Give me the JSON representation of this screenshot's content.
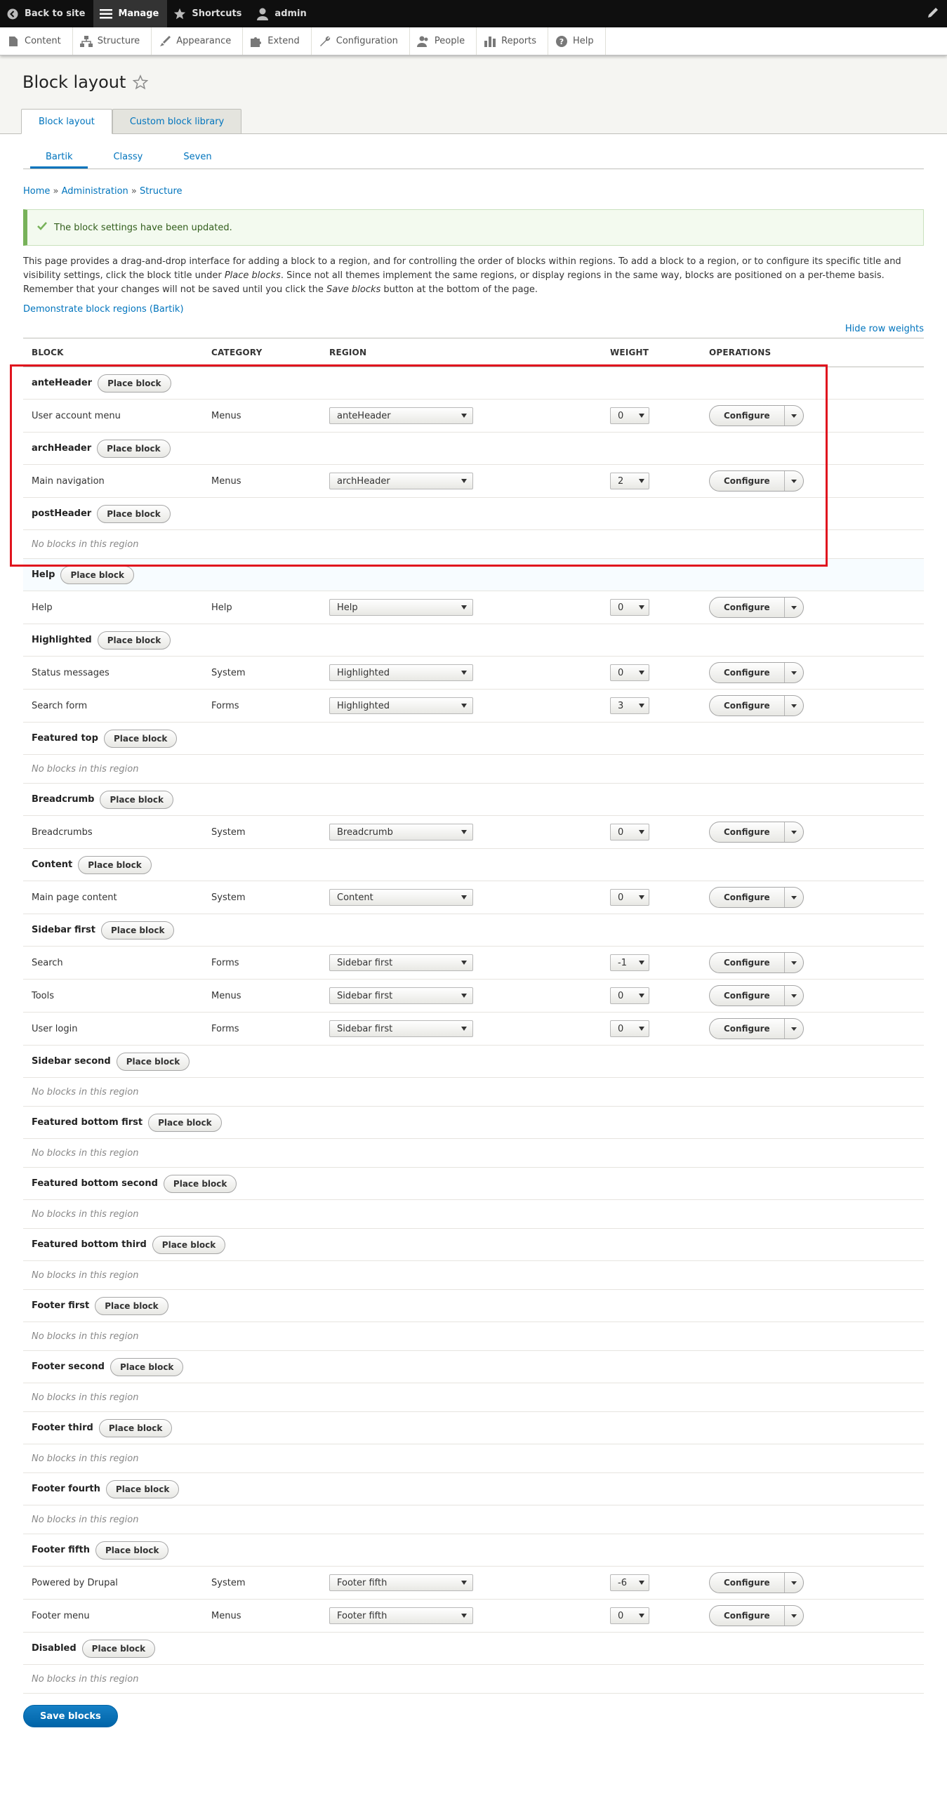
{
  "toolbar": {
    "items": [
      {
        "label": "Back to site",
        "icon": "back-arrow-icon"
      },
      {
        "label": "Manage",
        "icon": "hamburger-icon"
      },
      {
        "label": "Shortcuts",
        "icon": "star-icon"
      },
      {
        "label": "admin",
        "icon": "user-icon"
      }
    ],
    "edit_icon": "pencil-icon"
  },
  "tray": {
    "items": [
      {
        "label": "Content",
        "icon": "document-icon"
      },
      {
        "label": "Structure",
        "icon": "structure-icon"
      },
      {
        "label": "Appearance",
        "icon": "brush-icon"
      },
      {
        "label": "Extend",
        "icon": "puzzle-icon"
      },
      {
        "label": "Configuration",
        "icon": "wrench-icon"
      },
      {
        "label": "People",
        "icon": "people-icon"
      },
      {
        "label": "Reports",
        "icon": "bars-icon"
      },
      {
        "label": "Help",
        "icon": "question-icon"
      }
    ]
  },
  "page": {
    "title": "Block layout",
    "primary_tabs": [
      "Block layout",
      "Custom block library"
    ],
    "secondary_tabs": [
      "Bartik",
      "Classy",
      "Seven"
    ],
    "breadcrumb": [
      "Home",
      "Administration",
      "Structure"
    ],
    "breadcrumb_sep": "»",
    "message": "The block settings have been updated.",
    "help_text_1": "This page provides a drag-and-drop interface for adding a block to a region, and for controlling the order of blocks within regions. To add a block to a region, or to configure its specific title and visibility settings, click the block title under ",
    "help_em_1": "Place blocks",
    "help_text_2": ". Since not all themes implement the same regions, or display regions in the same way, blocks are positioned on a per-theme basis. Remember that your changes will not be saved until you click the ",
    "help_em_2": "Save blocks",
    "help_text_3": " button at the bottom of the page.",
    "demo_link": "Demonstrate block regions (Bartik)",
    "hide_row_weights": "Hide row weights",
    "save_button": "Save blocks"
  },
  "table": {
    "headers": [
      "BLOCK",
      "CATEGORY",
      "REGION",
      "WEIGHT",
      "OPERATIONS"
    ],
    "place_block_label": "Place block",
    "empty_label": "No blocks in this region",
    "configure_label": "Configure",
    "rows": [
      {
        "type": "region",
        "title": "anteHeader"
      },
      {
        "type": "block",
        "name": "User account menu",
        "category": "Menus",
        "region": "anteHeader",
        "weight": "0"
      },
      {
        "type": "region",
        "title": "archHeader"
      },
      {
        "type": "block",
        "name": "Main navigation",
        "category": "Menus",
        "region": "archHeader",
        "weight": "2"
      },
      {
        "type": "region",
        "title": "postHeader"
      },
      {
        "type": "empty"
      },
      {
        "type": "region",
        "title": "Help",
        "highlight": true
      },
      {
        "type": "block",
        "name": "Help",
        "category": "Help",
        "region": "Help",
        "weight": "0"
      },
      {
        "type": "region",
        "title": "Highlighted"
      },
      {
        "type": "block",
        "name": "Status messages",
        "category": "System",
        "region": "Highlighted",
        "weight": "0"
      },
      {
        "type": "block",
        "name": "Search form",
        "category": "Forms",
        "region": "Highlighted",
        "weight": "3"
      },
      {
        "type": "region",
        "title": "Featured top"
      },
      {
        "type": "empty"
      },
      {
        "type": "region",
        "title": "Breadcrumb"
      },
      {
        "type": "block",
        "name": "Breadcrumbs",
        "category": "System",
        "region": "Breadcrumb",
        "weight": "0"
      },
      {
        "type": "region",
        "title": "Content"
      },
      {
        "type": "block",
        "name": "Main page content",
        "category": "System",
        "region": "Content",
        "weight": "0"
      },
      {
        "type": "region",
        "title": "Sidebar first"
      },
      {
        "type": "block",
        "name": "Search",
        "category": "Forms",
        "region": "Sidebar first",
        "weight": "-1"
      },
      {
        "type": "block",
        "name": "Tools",
        "category": "Menus",
        "region": "Sidebar first",
        "weight": "0"
      },
      {
        "type": "block",
        "name": "User login",
        "category": "Forms",
        "region": "Sidebar first",
        "weight": "0"
      },
      {
        "type": "region",
        "title": "Sidebar second"
      },
      {
        "type": "empty"
      },
      {
        "type": "region",
        "title": "Featured bottom first"
      },
      {
        "type": "empty"
      },
      {
        "type": "region",
        "title": "Featured bottom second"
      },
      {
        "type": "empty"
      },
      {
        "type": "region",
        "title": "Featured bottom third"
      },
      {
        "type": "empty"
      },
      {
        "type": "region",
        "title": "Footer first"
      },
      {
        "type": "empty"
      },
      {
        "type": "region",
        "title": "Footer second"
      },
      {
        "type": "empty"
      },
      {
        "type": "region",
        "title": "Footer third"
      },
      {
        "type": "empty"
      },
      {
        "type": "region",
        "title": "Footer fourth"
      },
      {
        "type": "empty"
      },
      {
        "type": "region",
        "title": "Footer fifth"
      },
      {
        "type": "block",
        "name": "Powered by Drupal",
        "category": "System",
        "region": "Footer fifth",
        "weight": "-6"
      },
      {
        "type": "block",
        "name": "Footer menu",
        "category": "Menus",
        "region": "Footer fifth",
        "weight": "0"
      },
      {
        "type": "region",
        "title": "Disabled"
      },
      {
        "type": "empty"
      }
    ]
  },
  "colors": {
    "link": "#0074bd",
    "highlight_box": "#e0141e",
    "message_border": "#77b259",
    "primary_button": "#0071b8"
  }
}
